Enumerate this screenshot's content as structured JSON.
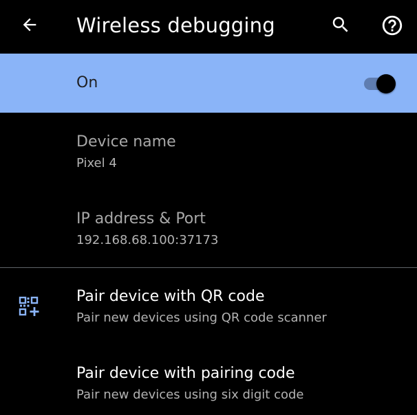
{
  "header": {
    "title": "Wireless debugging",
    "back_icon": "arrow-back-icon",
    "search_icon": "search-icon",
    "help_icon": "help-icon"
  },
  "main_switch": {
    "label": "On",
    "checked": true,
    "background_color": "#8ab4f8"
  },
  "info": [
    {
      "title": "Device name",
      "summary": "Pixel 4"
    },
    {
      "title": "IP address & Port",
      "summary": "192.168.68.100:37173"
    }
  ],
  "actions": [
    {
      "icon": "qr-code-scanner-icon",
      "title": "Pair device with QR code",
      "summary": "Pair new devices using QR code scanner"
    },
    {
      "title": "Pair device with pairing code",
      "summary": "Pair new devices using six digit code"
    }
  ],
  "colors": {
    "accent": "#8ab4f8",
    "icon_tint": "#8ab4f8"
  }
}
